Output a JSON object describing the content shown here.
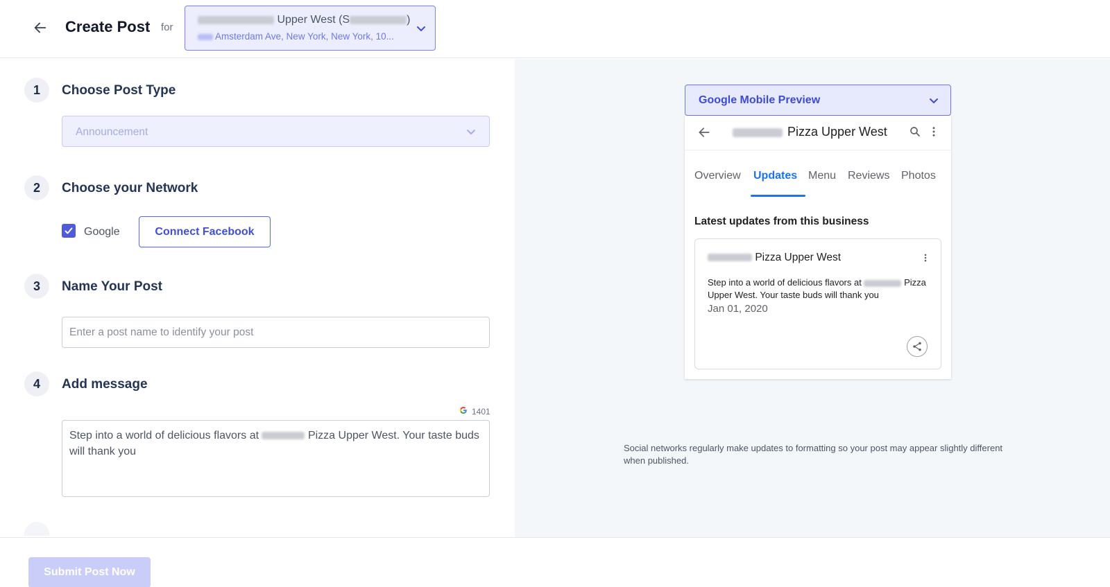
{
  "header": {
    "title": "Create Post",
    "for_label": "for",
    "location": {
      "name": "Upper West (S",
      "name_suffix": ")",
      "address": "Amsterdam Ave, New York, New York, 10..."
    }
  },
  "steps": [
    {
      "number": "1",
      "title": "Choose Post Type"
    },
    {
      "number": "2",
      "title": "Choose your Network"
    },
    {
      "number": "3",
      "title": "Name Your Post"
    },
    {
      "number": "4",
      "title": "Add message"
    }
  ],
  "post_type": {
    "selected": "Announcement"
  },
  "network": {
    "google_label": "Google",
    "google_checked": true,
    "connect_facebook_label": "Connect Facebook"
  },
  "post_name": {
    "placeholder": "Enter a post name to identify your post",
    "value": ""
  },
  "message": {
    "char_count": "1401",
    "count_icon": "google-g-icon",
    "text_before": "Step into a world of delicious flavors at",
    "text_after": "Pizza Upper West. Your taste buds will thank you"
  },
  "preview": {
    "selector_label": "Google Mobile Preview",
    "business_name": "Pizza Upper West",
    "tabs": [
      {
        "label": "Overview",
        "active": false
      },
      {
        "label": "Updates",
        "active": true
      },
      {
        "label": "Menu",
        "active": false
      },
      {
        "label": "Reviews",
        "active": false
      },
      {
        "label": "Photos",
        "active": false
      }
    ],
    "latest_heading": "Latest updates from this business",
    "card": {
      "title": "Pizza Upper West",
      "body_before": "Step into a world of delicious flavors at",
      "body_after": "Pizza Upper West. Your taste buds will thank you",
      "date": "Jan 01, 2020"
    },
    "disclaimer": "Social networks regularly make updates to formatting so your post may appear slightly different when published."
  },
  "footer": {
    "submit_label": "Submit Post Now"
  },
  "colors": {
    "accent": "#4f5bdb",
    "google_blue": "#1a73e8",
    "submit_disabled": "#c9cdf8"
  }
}
